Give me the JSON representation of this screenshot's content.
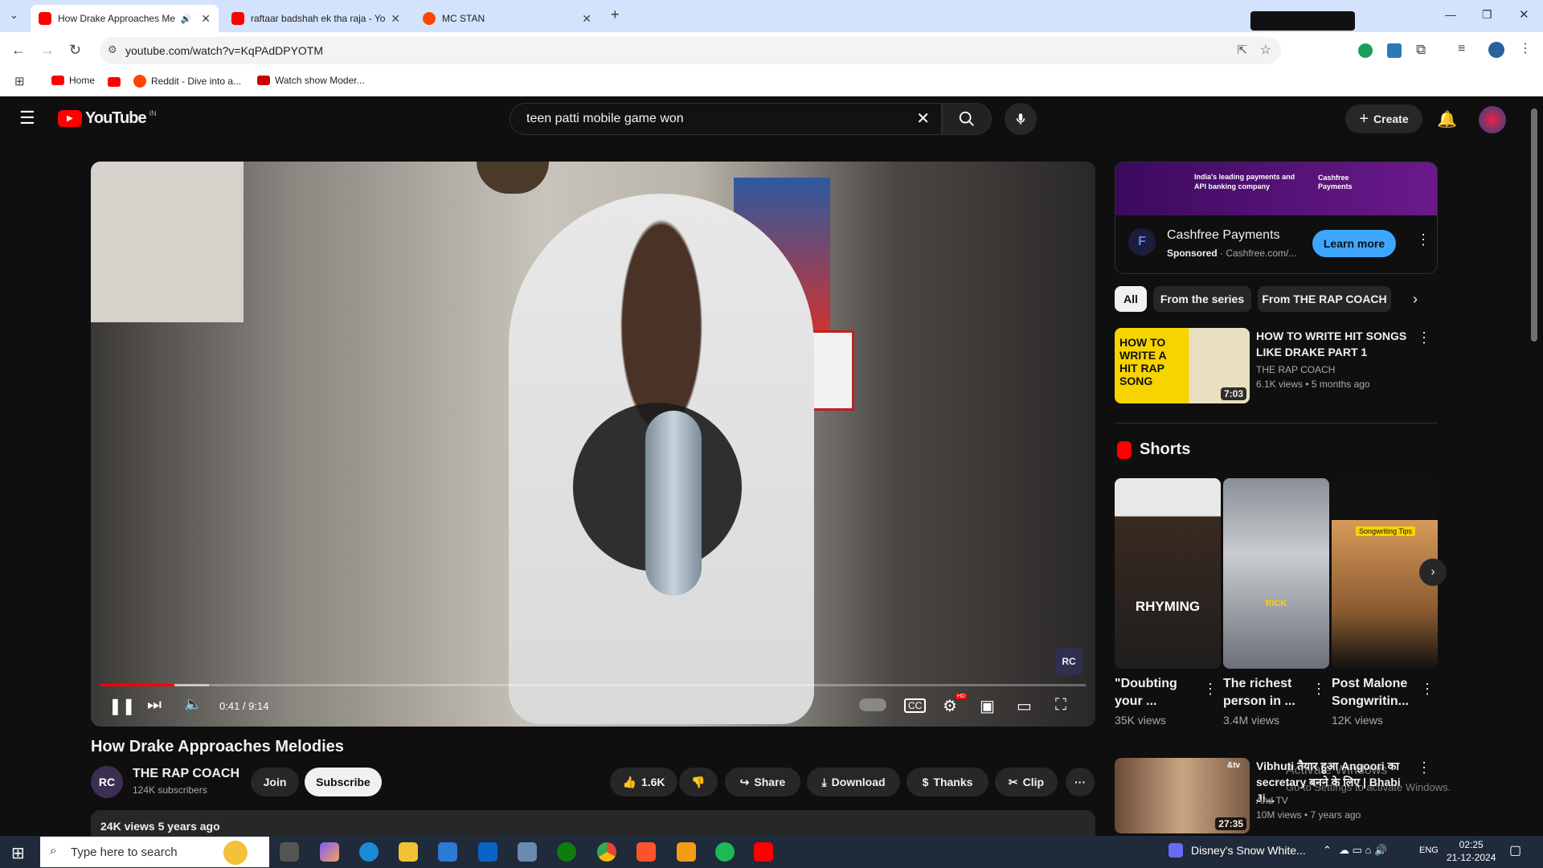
{
  "browser": {
    "tabs": [
      {
        "title": "How Drake Approaches Me",
        "color": "#ff0000"
      },
      {
        "title": "raftaar badshah ek tha raja - Yo",
        "color": "#ff0000"
      },
      {
        "title": "MC STAN",
        "color": "#ff4500"
      }
    ],
    "url": "youtube.com/watch?v=KqPAdDPYOTM",
    "bookmarks": [
      "Home",
      "Reddit - Dive into a...",
      "Watch show Moder..."
    ]
  },
  "youtube": {
    "logo_text": "YouTube",
    "region": "IN",
    "search_value": "teen patti mobile game won",
    "create_label": "Create"
  },
  "player": {
    "time": "0:41 / 9:14",
    "progress": 0.075,
    "buffered": 0.11,
    "watermark": "RC",
    "hd_badge": "HD"
  },
  "video": {
    "title": "How Drake Approaches Melodies",
    "channel": "THE RAP COACH",
    "channel_initials": "RC",
    "subscribers": "124K subscribers",
    "join": "Join",
    "subscribe": "Subscribe",
    "likes": "1.6K",
    "share": "Share",
    "download": "Download",
    "thanks": "Thanks",
    "clip": "Clip",
    "views_date": "24K views  5 years ago"
  },
  "ad": {
    "banner_text": "India's leading payments and API banking company",
    "brand_banner": "Cashfree Payments",
    "name": "Cashfree Payments",
    "sponsored": "Sponsored",
    "domain": "· Cashfree.com/...",
    "cta": "Learn more"
  },
  "chips": [
    "All",
    "From the series",
    "From THE RAP COACH"
  ],
  "recommended": [
    {
      "title": "HOW TO WRITE HIT SONGS LIKE DRAKE PART 1",
      "channel": "THE RAP COACH",
      "meta": "6.1K views • 5 months ago",
      "duration": "7:03",
      "thumb_text": "HOW TO WRITE A HIT RAP SONG"
    },
    {
      "title": "Vibhuti तैयार हुआ Angoori का secretary बनने के लिए | Bhabi Ji...",
      "channel": "And TV",
      "meta": "10M views • 7 years ago",
      "duration": "27:35",
      "thumb_text": "&tv"
    }
  ],
  "shorts": {
    "heading": "Shorts",
    "items": [
      {
        "title": "\"Doubting your ...",
        "views": "35K views",
        "overlay": "RHYMING"
      },
      {
        "title": "The richest person in ...",
        "views": "3.4M views",
        "overlay": "RICK"
      },
      {
        "title": "Post Malone Songwritin...",
        "views": "12K views",
        "overlay": "Songwriting Tips"
      }
    ]
  },
  "windows": {
    "activate_title": "Activate Windows",
    "activate_sub": "Go to Settings to activate Windows.",
    "search_placeholder": "Type here to search",
    "media": "Disney's Snow White...",
    "lang": "ENG",
    "time": "02:25",
    "date": "21-12-2024"
  }
}
